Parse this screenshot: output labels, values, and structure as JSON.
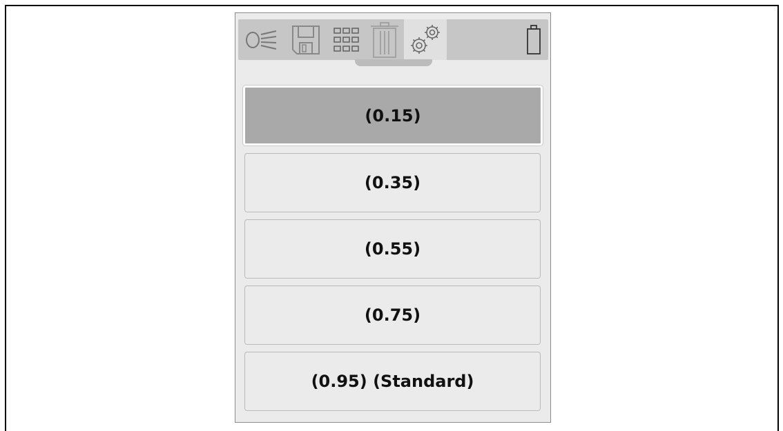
{
  "toolbar": {
    "icons": [
      "headlight-icon",
      "save-icon",
      "grid-icon",
      "trash-icon",
      "settings-gears-icon",
      "battery-icon"
    ],
    "active_tool": "settings-gears-icon"
  },
  "options": [
    {
      "label": "(0.15)",
      "selected": true
    },
    {
      "label": "(0.35)",
      "selected": false
    },
    {
      "label": "(0.55)",
      "selected": false
    },
    {
      "label": "(0.75)",
      "selected": false
    },
    {
      "label": "(0.95) (Standard)",
      "selected": false
    }
  ],
  "colors": {
    "toolbar_bg": "#c6c6c6",
    "panel_bg": "#ebebeb",
    "selected_bg": "#a9a9a9",
    "icon_stroke": "#777777"
  }
}
